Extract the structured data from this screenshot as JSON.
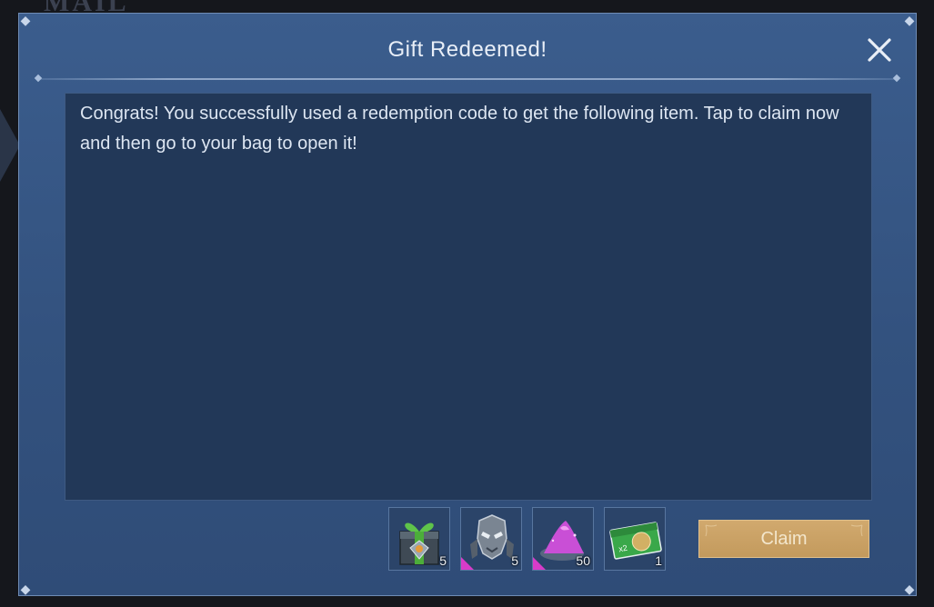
{
  "background": {
    "title": "MAIL"
  },
  "dialog": {
    "title": "Gift Redeemed!",
    "message": "Congrats! You successfully used a redemption code to get the following item. Tap to claim now and then go to your bag to open it!",
    "close_icon": "close-icon"
  },
  "items": [
    {
      "icon": "gift-box-icon",
      "quantity": "5",
      "rarity_mark": false
    },
    {
      "icon": "hero-fragment-icon",
      "quantity": "5",
      "rarity_mark": true
    },
    {
      "icon": "magic-dust-icon",
      "quantity": "50",
      "rarity_mark": true
    },
    {
      "icon": "exp-card-icon",
      "quantity": "1",
      "rarity_mark": false
    }
  ],
  "claim_button": {
    "label": "Claim"
  },
  "colors": {
    "dialog_bg": "#33527f",
    "message_bg": "#223858",
    "claim_bg": "#c39a5d",
    "rarity": "#d83bc9"
  }
}
